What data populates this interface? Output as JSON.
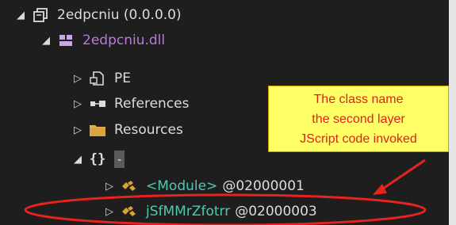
{
  "tree": {
    "assembly": {
      "label": "2edpcniu (0.0.0.0)"
    },
    "module": {
      "label": "2edpcniu.dll"
    },
    "pe": {
      "label": "PE"
    },
    "references": {
      "label": "References"
    },
    "resources": {
      "label": "Resources"
    },
    "namespace": {
      "label": "-"
    },
    "type_module": {
      "name": "<Module>",
      "token": "@02000001"
    },
    "type_target": {
      "name": "jSfMMrZfotrr",
      "token": "@02000003"
    }
  },
  "annotation": {
    "line1": "The class name",
    "line2": "the second layer",
    "line3": "JScript code invoked"
  },
  "colors": {
    "background": "#1e1e1e",
    "type_name": "#4ec9b0",
    "dll_name": "#b97ad9",
    "annotation_fill": "#ffff66",
    "annotation_text": "#e1201e",
    "highlight": "#e8231f"
  },
  "icons": {
    "expanded": "triangle-down-icon",
    "collapsed": "triangle-right-icon",
    "assembly": "assembly-icon",
    "module": "dll-module-icon",
    "pe": "pe-file-icon",
    "references": "references-icon",
    "resources": "folder-icon",
    "namespace": "namespace-braces-icon",
    "class": "class-icon"
  }
}
